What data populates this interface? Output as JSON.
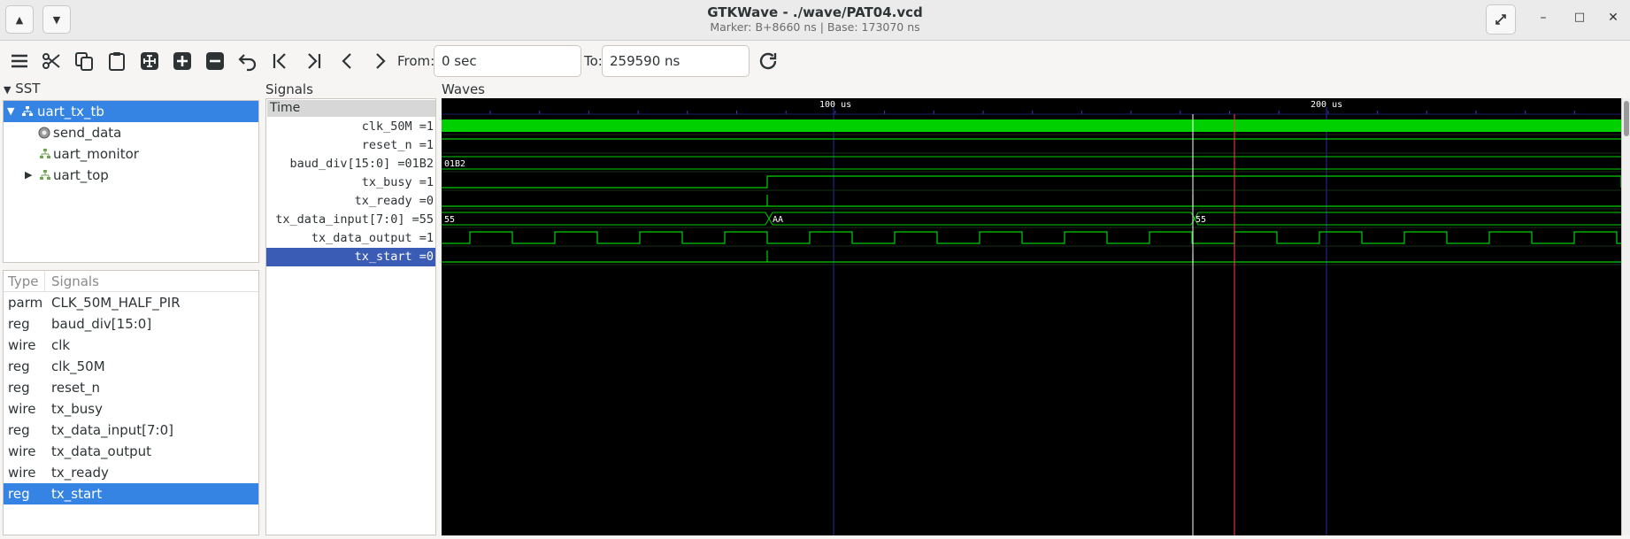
{
  "window": {
    "title": "GTKWave - ./wave/PAT04.vcd",
    "subtitle": "Marker: B+8660 ns  |  Base: 173070 ns"
  },
  "toolbar": {
    "from_label": "From:",
    "from_value": "0 sec",
    "to_label": "To:",
    "to_value": "259590 ns"
  },
  "sst": {
    "label": "SST",
    "tree": [
      {
        "label": "uart_tx_tb",
        "icon": "module-icon",
        "selected": true
      },
      {
        "label": "send_data",
        "icon": "task-gear-icon",
        "selected": false
      },
      {
        "label": "uart_monitor",
        "icon": "module-icon",
        "selected": false
      },
      {
        "label": "uart_top",
        "icon": "module-icon",
        "selected": false
      }
    ]
  },
  "signals_table": {
    "type_header": "Type",
    "signals_header": "Signals",
    "rows": [
      {
        "type": "parm",
        "name": "CLK_50M_HALF_PIR"
      },
      {
        "type": "reg",
        "name": "baud_div[15:0]"
      },
      {
        "type": "wire",
        "name": "clk"
      },
      {
        "type": "reg",
        "name": "clk_50M"
      },
      {
        "type": "reg",
        "name": "reset_n"
      },
      {
        "type": "wire",
        "name": "tx_busy"
      },
      {
        "type": "reg",
        "name": "tx_data_input[7:0]"
      },
      {
        "type": "wire",
        "name": "tx_data_output"
      },
      {
        "type": "wire",
        "name": "tx_ready"
      },
      {
        "type": "reg",
        "name": "tx_start"
      }
    ]
  },
  "signals_pane": {
    "label": "Signals",
    "time_header": "Time",
    "rows": [
      "clk_50M =1",
      "reset_n =1",
      "baud_div[15:0] =01B2",
      "tx_busy =1",
      "tx_ready =0",
      "tx_data_input[7:0] =55",
      "tx_data_output =1",
      "tx_start =0"
    ]
  },
  "waves_pane": {
    "label": "Waves",
    "time_labels": [
      "100 us",
      "200 us"
    ],
    "bus_values": {
      "baud_div": [
        "01B2"
      ],
      "tx_data_input": [
        "55",
        "AA",
        "55"
      ]
    }
  },
  "colors": {
    "wave": "#00d000",
    "marker": "#ff4040",
    "cursor": "#ffffff",
    "selection": "#3584e4",
    "grid": "#2a2aa0"
  }
}
